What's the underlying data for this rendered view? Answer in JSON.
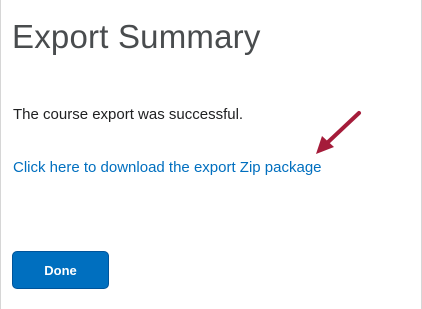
{
  "export_summary": {
    "title": "Export Summary",
    "status_message": "The course export was successful.",
    "download_link_text": "Click here to download the export Zip package",
    "done_button_label": "Done"
  },
  "annotation": {
    "arrow_icon": "arrow-pointer-icon",
    "arrow_color": "#a51c3a"
  },
  "colors": {
    "link": "#006fbf",
    "button_bg": "#006fbf",
    "title_text": "#494c4e"
  }
}
